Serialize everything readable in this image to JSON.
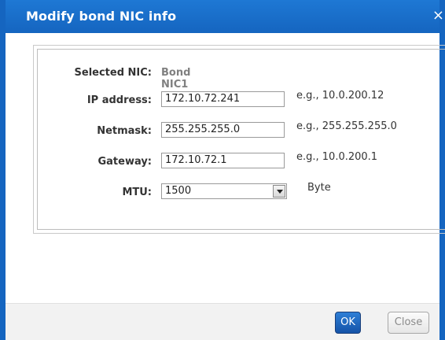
{
  "dialog": {
    "title": "Modify bond NIC info",
    "close_glyph": "×"
  },
  "form": {
    "selected_nic": {
      "label": "Selected NIC:",
      "value": "Bond NIC1"
    },
    "ip_address": {
      "label": "IP address:",
      "value": "172.10.72.241",
      "hint": "e.g., 10.0.200.12"
    },
    "netmask": {
      "label": "Netmask:",
      "value": "255.255.255.0",
      "hint": "e.g., 255.255.255.0"
    },
    "gateway": {
      "label": "Gateway:",
      "value": "172.10.72.1",
      "hint": "e.g., 10.0.200.1"
    },
    "mtu": {
      "label": "MTU:",
      "value": "1500",
      "unit": "Byte"
    }
  },
  "footer": {
    "ok_label": "OK",
    "close_label": "Close"
  },
  "colors": {
    "accent": "#1565c0",
    "ok_button": "#1e6cc8"
  }
}
